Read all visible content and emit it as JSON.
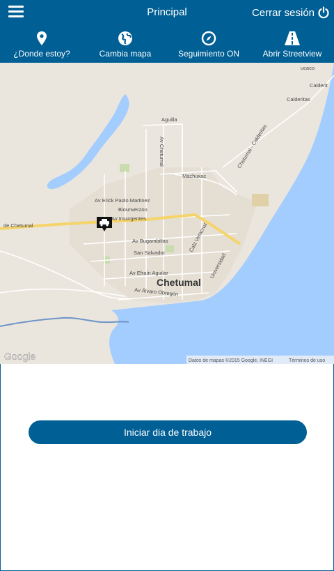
{
  "header": {
    "title": "Principal",
    "logout_label": "Cerrar sesión",
    "menu_icon": "menu-icon",
    "power_icon": "power-icon"
  },
  "nav": [
    {
      "label": "¿Donde estoy?",
      "icon": "location-pin-icon"
    },
    {
      "label": "Cambia mapa",
      "icon": "globe-icon"
    },
    {
      "label": "Seguimiento ON",
      "icon": "compass-icon"
    },
    {
      "label": "Abrir Streetview",
      "icon": "road-icon"
    }
  ],
  "map": {
    "city_label": "Chetumal",
    "places": {
      "calderitas_upper": "Calderit",
      "calderitas": "Calderitas",
      "aguilla": "Aguilla",
      "av_chetumal": "Av Chetumal",
      "machuxac": "Machuxac",
      "chetumal_calderitas": "Chetumal - Calderitas",
      "av_erick": "Av Erick Paolo Martinez",
      "biounverzoo": "Biounverzoo",
      "av_insurgentes": "Av Insurgentes",
      "de_chetumal": "de Chetumal",
      "av_bugambilias": "Av Bugambilias",
      "calz_veracruz": "Calz Veracruz",
      "san_salvador": "San Salvador",
      "universidad": "Universidad",
      "av_efrain": "Av Efraín Aguilar",
      "av_alvaro": "Av Álvaro Obregón",
      "ucaco": "ucaco"
    },
    "google_logo": "Google",
    "attribution": "Datos de mapas ©2015 Google, INEGI",
    "terms": "Términos de uso",
    "marker_icon": "car-marker-icon"
  },
  "action": {
    "start_label": "Iniciar dia de trabajo"
  }
}
